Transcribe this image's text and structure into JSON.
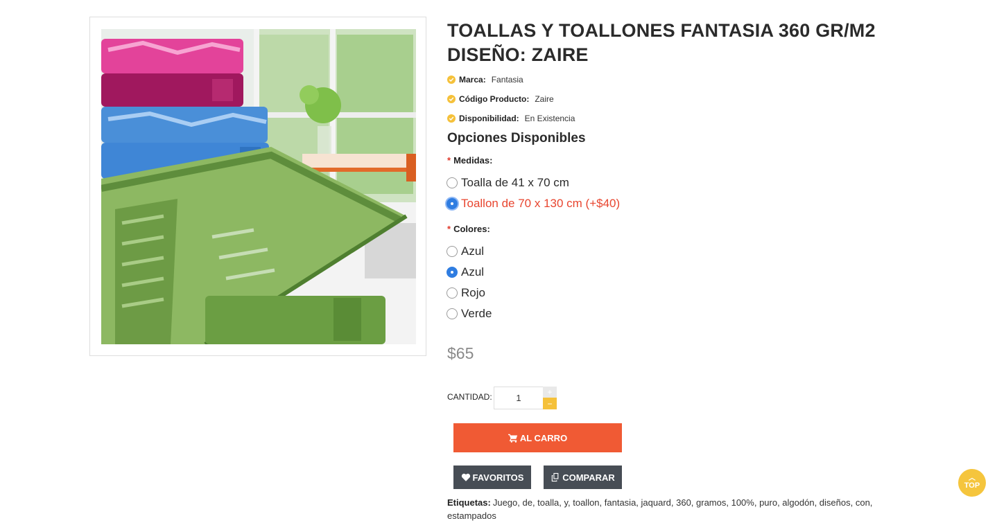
{
  "product": {
    "title": "TOALLAS Y TOALLONES FANTASIA 360 GR/M2 DISEÑO: ZAIRE",
    "meta": [
      {
        "label": "Marca:",
        "value": "Fantasia"
      },
      {
        "label": "Código Producto:",
        "value": "Zaire"
      },
      {
        "label": "Disponibilidad:",
        "value": "En Existencia"
      }
    ]
  },
  "options": {
    "heading": "Opciones Disponibles",
    "required_mark": "*",
    "medidas": {
      "label": "Medidas:",
      "choices": [
        "Toalla de 41 x 70 cm",
        "Toallon de 70 x 130 cm (+$40)"
      ],
      "selected": "Toallon de 70 x 130 cm (+$40)"
    },
    "colores": {
      "label": "Colores:",
      "choices": [
        "Azul",
        "Azul",
        "Rojo",
        "Verde"
      ],
      "selected_index": 1
    }
  },
  "price": "$65",
  "quantity": {
    "label": "CANTIDAD:",
    "value": "1",
    "plus": "+",
    "minus": "−"
  },
  "buttons": {
    "cart": "AL CARRO",
    "favorites": "FAVORITOS",
    "compare": "COMPARAR"
  },
  "tags": {
    "label": "Etiquetas:",
    "text": "Juego, de, toalla, y, toallon, fantasia, jaquard, 360, gramos, 100%, puro, algodón, diseños, con, estampados"
  },
  "scroll_top": {
    "label": "TOP"
  },
  "colors": {
    "accent_orange": "#f05a34",
    "accent_yellow": "#f5c13a",
    "dark_button": "#474d55",
    "selected_red": "#e8452f",
    "radio_blue": "#2f7de1"
  }
}
